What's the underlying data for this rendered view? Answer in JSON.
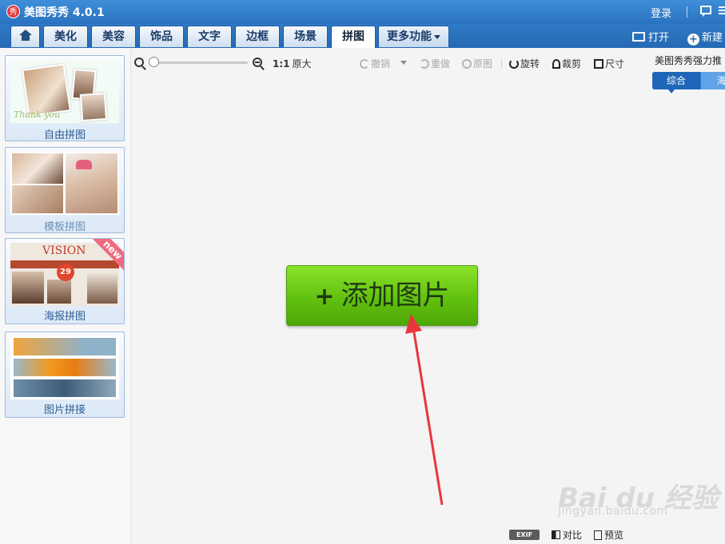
{
  "app": {
    "logo_glyph": "秀",
    "title": "美图秀秀 4.0.1"
  },
  "titlebar": {
    "login": "登录"
  },
  "tabs": [
    {
      "label": "美化"
    },
    {
      "label": "美容"
    },
    {
      "label": "饰品"
    },
    {
      "label": "文字"
    },
    {
      "label": "边框"
    },
    {
      "label": "场景"
    },
    {
      "label": "拼图",
      "active": true
    },
    {
      "label": "更多功能"
    }
  ],
  "tabbar_actions": {
    "open": "打开",
    "new": "新建"
  },
  "left_panel": {
    "cards": [
      {
        "label": "自由拼图",
        "thumb_text": "Thank you"
      },
      {
        "label": "模板拼图"
      },
      {
        "label": "海报拼图",
        "thumb_text": "VISION",
        "badge": "new",
        "number": "29"
      },
      {
        "label": "图片拼接"
      }
    ]
  },
  "toolbar": {
    "ratio": "1:1",
    "original_size": "原大",
    "undo": "撤销",
    "redo": "重做",
    "original": "原图",
    "rotate": "旋转",
    "crop": "裁剪",
    "size": "尺寸"
  },
  "promo": {
    "title": "美图秀秀强力推",
    "tab_active": "综合",
    "tab_second": "海"
  },
  "main": {
    "add_button_plus": "+",
    "add_button": "添加图片"
  },
  "watermark": {
    "text": "Bai du 经验",
    "sub": "jingyan.baidu.com"
  },
  "bottom_bar": {
    "exif": "EXIF",
    "compare": "对比",
    "preview": "预览"
  },
  "colors": {
    "titlebar": "#3f8ed8",
    "tabbar": "#2569b3",
    "add_button": "#62c10e",
    "arrow": "#e8363c"
  }
}
